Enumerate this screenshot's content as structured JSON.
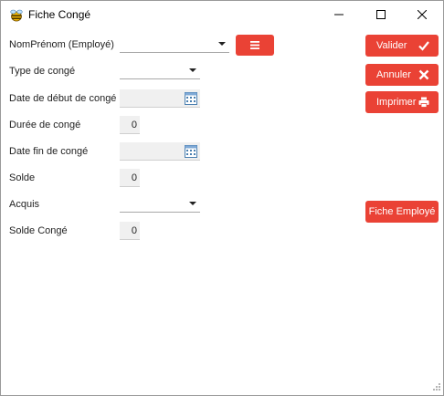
{
  "window": {
    "title": "Fiche Congé",
    "app_icon": "bee-app-icon",
    "controls": [
      "minimize-icon",
      "maximize-icon",
      "close-icon"
    ]
  },
  "form": {
    "employee": {
      "label": "NomPrénom (Employé)",
      "value": ""
    },
    "leave_type": {
      "label": "Type de congé",
      "value": ""
    },
    "start_date": {
      "label": "Date de début de congé",
      "value": ""
    },
    "duration": {
      "label": "Durée de congé",
      "value": "0"
    },
    "end_date": {
      "label": "Date fin de congé",
      "value": ""
    },
    "balance": {
      "label": "Solde",
      "value": "0"
    },
    "acquis": {
      "label": "Acquis",
      "value": ""
    },
    "leave_balance": {
      "label": "Solde Congé",
      "value": "0"
    }
  },
  "actions": {
    "validate": {
      "label": "Valider",
      "icon": "check-icon"
    },
    "cancel": {
      "label": "Annuler",
      "icon": "x-icon"
    },
    "print": {
      "label": "Imprimer",
      "icon": "printer-icon"
    },
    "employee_sheet": {
      "label": "Fiche Employé"
    },
    "menu_icon": "list-icon"
  },
  "colors": {
    "accent": "#ea4235",
    "field_bg": "#f0f0f0"
  }
}
